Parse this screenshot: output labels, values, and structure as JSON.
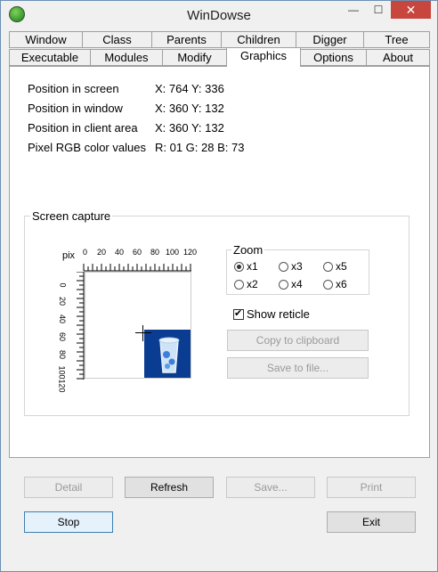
{
  "window": {
    "title": "WinDowse"
  },
  "titlebar_buttons": {
    "minimize": "—",
    "maximize": "☐",
    "close": "✕"
  },
  "tabs_row1": [
    "Window",
    "Class",
    "Parents",
    "Children",
    "Digger",
    "Tree"
  ],
  "tabs_row2": [
    "Executable",
    "Modules",
    "Modify",
    "Graphics",
    "Options",
    "About"
  ],
  "active_tab": "Graphics",
  "info": {
    "screen": {
      "label": "Position in screen",
      "value": "X: 764  Y: 336"
    },
    "window": {
      "label": "Position in window",
      "value": "X: 360  Y: 132"
    },
    "client": {
      "label": "Position in client area",
      "value": "X: 360  Y: 132"
    },
    "rgb": {
      "label": "Pixel RGB color values",
      "value": "R: 01  G: 28  B: 73"
    }
  },
  "capture": {
    "title": "Screen capture",
    "ruler_unit": "pix",
    "x_ticks": [
      "0",
      "20",
      "40",
      "60",
      "80",
      "100",
      "120"
    ],
    "y_ticks": [
      "0",
      "20",
      "40",
      "60",
      "80",
      "100",
      "120"
    ]
  },
  "zoom": {
    "title": "Zoom",
    "options": [
      "x1",
      "x3",
      "x5",
      "x2",
      "x4",
      "x6"
    ],
    "selected": "x1"
  },
  "reticle": {
    "label": "Show reticle",
    "checked": true
  },
  "panel_buttons": {
    "copy": "Copy to clipboard",
    "save_file": "Save to file..."
  },
  "bottom": {
    "detail": "Detail",
    "refresh": "Refresh",
    "save": "Save...",
    "print": "Print",
    "stop": "Stop",
    "exit": "Exit"
  },
  "colors": {
    "capture_fill": "#0a3d91",
    "close_button": "#c7463d"
  }
}
